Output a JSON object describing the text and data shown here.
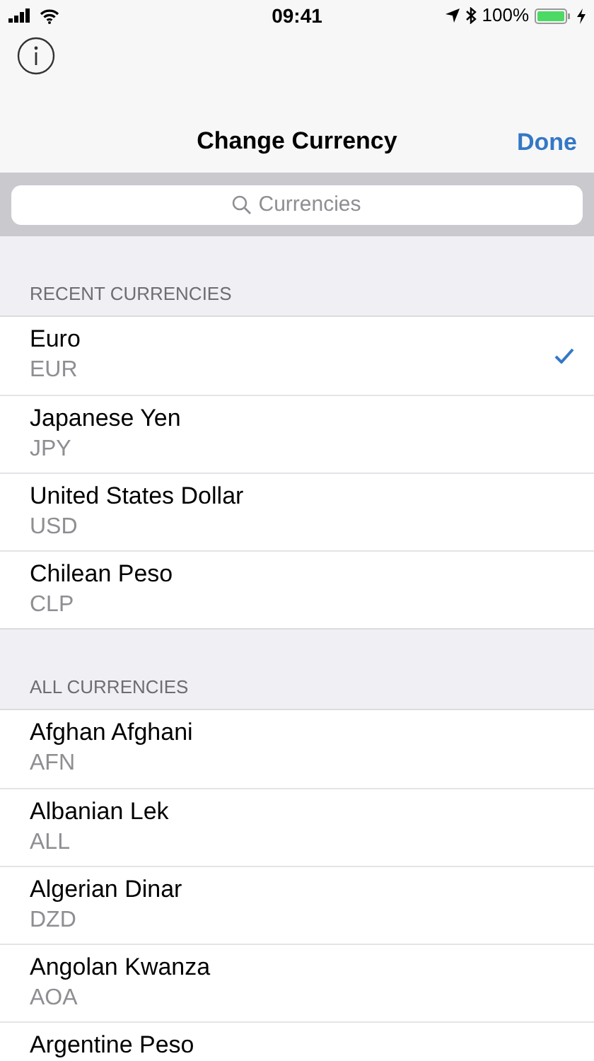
{
  "status_bar": {
    "time": "09:41",
    "battery": "100%",
    "charging": true
  },
  "nav_bar": {
    "title": "Change Currency",
    "done": "Done"
  },
  "search": {
    "placeholder": "Currencies"
  },
  "sections": [
    {
      "title": "RECENT CURRENCIES",
      "rows": [
        {
          "name": "Euro",
          "code": "EUR",
          "selected": true
        },
        {
          "name": "Japanese Yen",
          "code": "JPY",
          "selected": false
        },
        {
          "name": "United States Dollar",
          "code": "USD",
          "selected": false
        },
        {
          "name": "Chilean Peso",
          "code": "CLP",
          "selected": false
        }
      ]
    },
    {
      "title": "ALL CURRENCIES",
      "rows": [
        {
          "name": "Afghan Afghani",
          "code": "AFN",
          "selected": false
        },
        {
          "name": "Albanian Lek",
          "code": "ALL",
          "selected": false
        },
        {
          "name": "Algerian Dinar",
          "code": "DZD",
          "selected": false
        },
        {
          "name": "Angolan Kwanza",
          "code": "AOA",
          "selected": false
        },
        {
          "name": "Argentine Peso",
          "selected": false
        }
      ]
    }
  ]
}
